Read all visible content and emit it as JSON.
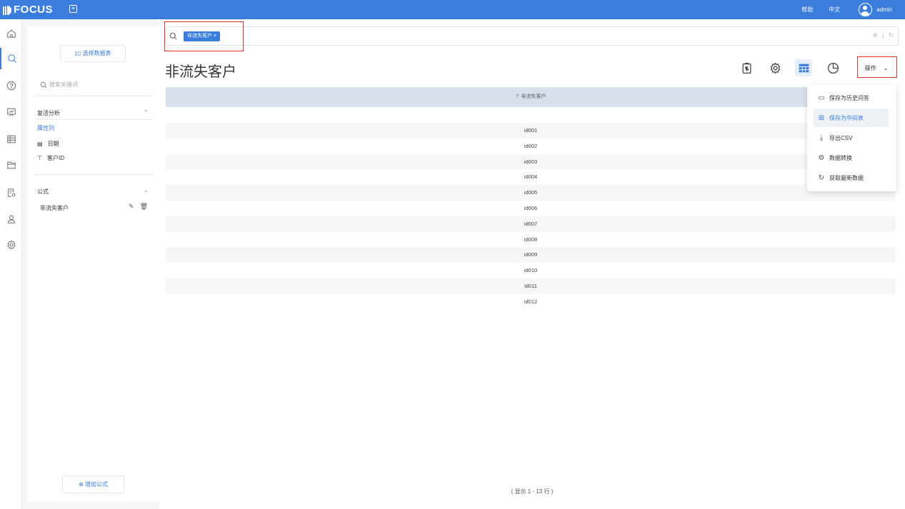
{
  "header": {
    "logo": "FOCUS",
    "help": "帮助",
    "lang": "中文",
    "user": "admin"
  },
  "panel": {
    "select_table": "选择数据表",
    "search_placeholder": "搜索关键词",
    "section1": "复活分析",
    "attr_label": "属性列",
    "fields": [
      {
        "icon": "calendar-icon",
        "label": "日期"
      },
      {
        "icon": "text-type-icon",
        "label": "客户ID"
      }
    ],
    "section2": "公式",
    "formula": "非流失客户",
    "add_formula": "增加公式"
  },
  "query": {
    "token": "非流失客户"
  },
  "main": {
    "title": "非流失客户",
    "ops_label": "操作"
  },
  "table": {
    "header": "非流失客户",
    "rows": [
      "id001",
      "id002",
      "id003",
      "id004",
      "id005",
      "id006",
      "id007",
      "id008",
      "id009",
      "id010",
      "id011",
      "id012"
    ],
    "footer": "( 显示 1 - 13 行 )"
  },
  "dropdown": {
    "items": [
      "保存为历史问答",
      "保存为中间表",
      "导出CSV",
      "数据转换",
      "获取最新数据"
    ],
    "selected": "保存为中间表"
  },
  "colors": {
    "brand": "#3a7ddc",
    "highlight": "#e0302e"
  }
}
